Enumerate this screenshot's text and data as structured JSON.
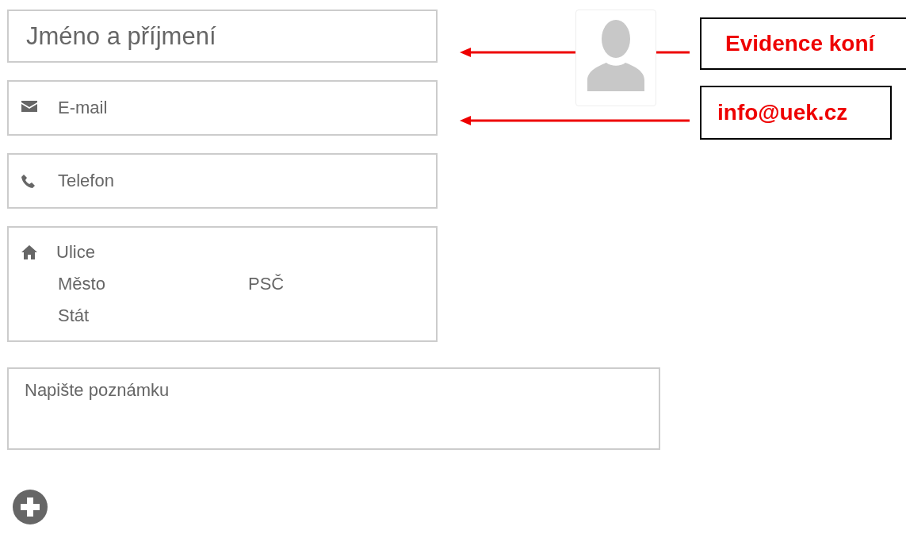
{
  "form": {
    "name": {
      "placeholder": "Jméno a příjmení"
    },
    "email": {
      "placeholder": "E-mail"
    },
    "phone": {
      "placeholder": "Telefon"
    },
    "address": {
      "street": {
        "placeholder": "Ulice"
      },
      "city": {
        "placeholder": "Město"
      },
      "zip": {
        "placeholder": "PSČ"
      },
      "country": {
        "placeholder": "Stát"
      }
    },
    "note": {
      "placeholder": "Napište poznámku"
    }
  },
  "annotations": [
    {
      "text": "Evidence koní"
    },
    {
      "text": "info@uek.cz"
    }
  ]
}
